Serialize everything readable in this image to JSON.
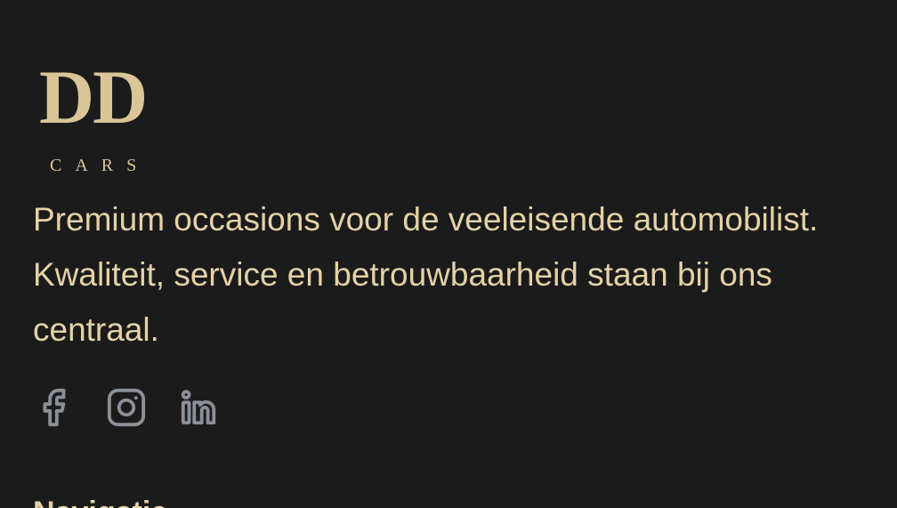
{
  "brand": {
    "logo_mark": "DD",
    "logo_sub": "CARS"
  },
  "tagline": "Premium occasions voor de veeleisende automobilist. Kwaliteit, service en betrouwbaarheid staan bij ons centraal.",
  "socials": [
    {
      "name": "facebook",
      "icon": "facebook-icon"
    },
    {
      "name": "instagram",
      "icon": "instagram-icon"
    },
    {
      "name": "linkedin",
      "icon": "linkedin-icon"
    }
  ],
  "next_section_heading": "Navigatie",
  "colors": {
    "background": "#1b1b1c",
    "gold": "#d9c596",
    "text": "#e4d2a6",
    "icon": "#8b8f98"
  }
}
